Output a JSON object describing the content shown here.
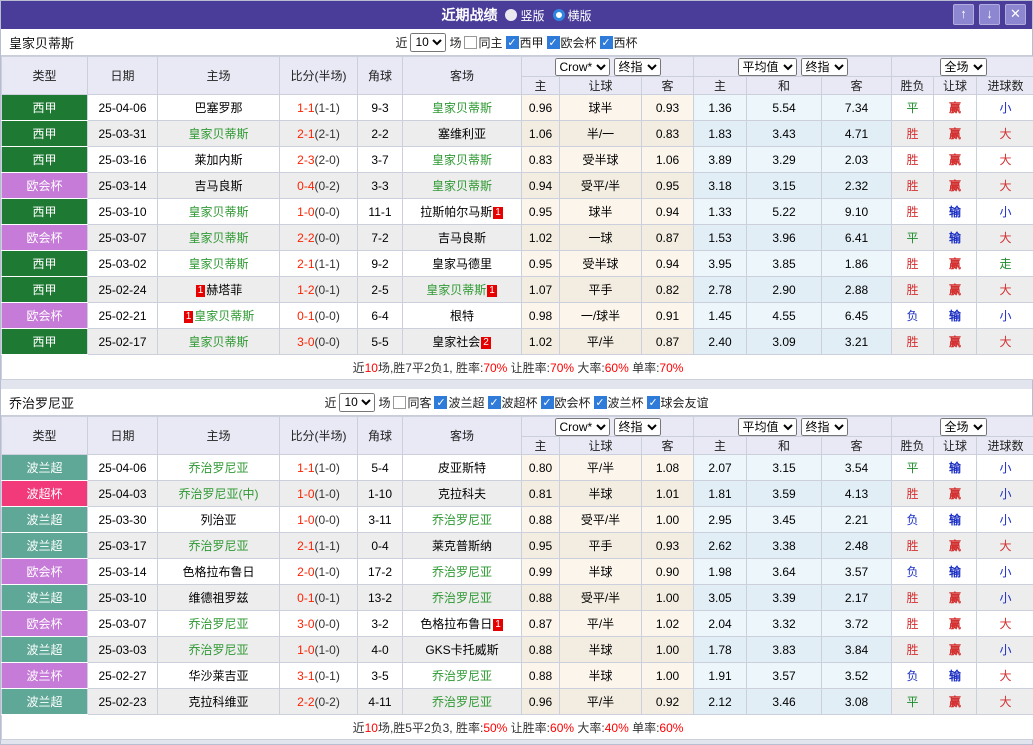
{
  "titlebar": {
    "title": "近期战绩",
    "radio_vertical": "竖版",
    "radio_horizontal": "横版",
    "up": "↑",
    "down": "↓",
    "close": "✕",
    "bg": "#4a3d99"
  },
  "columns": {
    "type": "类型",
    "date": "日期",
    "home": "主场",
    "score": "比分(半场)",
    "corner": "角球",
    "away": "客场",
    "odds_home": "主",
    "odds_handicap": "让球",
    "odds_away": "客",
    "avg_home": "主",
    "avg_draw": "和",
    "avg_away": "客",
    "result_wl": "胜负",
    "result_handicap": "让球",
    "result_goals": "进球数"
  },
  "selects": {
    "crow": "Crow*",
    "final1": "终指",
    "average": "平均值",
    "final2": "终指",
    "fullmatch": "全场"
  },
  "filter_words": {
    "near": "近",
    "games": "场"
  },
  "colors": {
    "league": {
      "西甲": "#1e7a33",
      "欧会杯": "#c77bd8",
      "波兰超": "#5fa897",
      "波超杯": "#f23a7b",
      "波兰杯": "#c77bd8"
    },
    "result": {
      "r": "#d43030",
      "g": "#1d8a2a",
      "b": "#1b2fc4"
    },
    "team_green": "#2e9932",
    "score_red": "#ff2200",
    "badge_red": "#e60000",
    "checkbox_blue": "#2f7bd9"
  },
  "sections": [
    {
      "team": "皇家贝蒂斯",
      "filter": {
        "count": "10",
        "same": "同主",
        "same_checked": false,
        "leagues": [
          "西甲",
          "欧会杯",
          "西杯"
        ]
      },
      "rows": [
        {
          "type": "西甲",
          "date": "25-04-06",
          "home": {
            "name": "巴塞罗那"
          },
          "ft": "1-1",
          "ht": "(1-1)",
          "corner": "9-3",
          "away": {
            "name": "皇家贝蒂斯",
            "green": true
          },
          "o1": "0.96",
          "hcp": "球半",
          "o2": "0.93",
          "a1": "1.36",
          "a2": "5.54",
          "a3": "7.34",
          "r1": {
            "t": "平",
            "c": "g"
          },
          "r2": {
            "t": "赢",
            "c": "r"
          },
          "r3": {
            "t": "小",
            "c": "b"
          }
        },
        {
          "type": "西甲",
          "date": "25-03-31",
          "home": {
            "name": "皇家贝蒂斯",
            "green": true
          },
          "ft": "2-1",
          "ht": "(2-1)",
          "corner": "2-2",
          "away": {
            "name": "塞维利亚"
          },
          "o1": "1.06",
          "hcp": "半/一",
          "o2": "0.83",
          "a1": "1.83",
          "a2": "3.43",
          "a3": "4.71",
          "r1": {
            "t": "胜",
            "c": "r"
          },
          "r2": {
            "t": "赢",
            "c": "r"
          },
          "r3": {
            "t": "大",
            "c": "r"
          }
        },
        {
          "type": "西甲",
          "date": "25-03-16",
          "home": {
            "name": "莱加内斯"
          },
          "ft": "2-3",
          "ht": "(2-0)",
          "corner": "3-7",
          "away": {
            "name": "皇家贝蒂斯",
            "green": true
          },
          "o1": "0.83",
          "hcp": "受半球",
          "o2": "1.06",
          "a1": "3.89",
          "a2": "3.29",
          "a3": "2.03",
          "r1": {
            "t": "胜",
            "c": "r"
          },
          "r2": {
            "t": "赢",
            "c": "r"
          },
          "r3": {
            "t": "大",
            "c": "r"
          }
        },
        {
          "type": "欧会杯",
          "date": "25-03-14",
          "home": {
            "name": "吉马良斯"
          },
          "ft": "0-4",
          "ht": "(0-2)",
          "corner": "3-3",
          "away": {
            "name": "皇家贝蒂斯",
            "green": true
          },
          "o1": "0.94",
          "hcp": "受平/半",
          "o2": "0.95",
          "a1": "3.18",
          "a2": "3.15",
          "a3": "2.32",
          "r1": {
            "t": "胜",
            "c": "r"
          },
          "r2": {
            "t": "赢",
            "c": "r"
          },
          "r3": {
            "t": "大",
            "c": "r"
          }
        },
        {
          "type": "西甲",
          "date": "25-03-10",
          "home": {
            "name": "皇家贝蒂斯",
            "green": true
          },
          "ft": "1-0",
          "ht": "(0-0)",
          "corner": "11-1",
          "away": {
            "name": "拉斯帕尔马斯",
            "suf": "1"
          },
          "o1": "0.95",
          "hcp": "球半",
          "o2": "0.94",
          "a1": "1.33",
          "a2": "5.22",
          "a3": "9.10",
          "r1": {
            "t": "胜",
            "c": "r"
          },
          "r2": {
            "t": "输",
            "c": "b"
          },
          "r3": {
            "t": "小",
            "c": "b"
          }
        },
        {
          "type": "欧会杯",
          "date": "25-03-07",
          "home": {
            "name": "皇家贝蒂斯",
            "green": true
          },
          "ft": "2-2",
          "ht": "(0-0)",
          "corner": "7-2",
          "away": {
            "name": "吉马良斯"
          },
          "o1": "1.02",
          "hcp": "一球",
          "o2": "0.87",
          "a1": "1.53",
          "a2": "3.96",
          "a3": "6.41",
          "r1": {
            "t": "平",
            "c": "g"
          },
          "r2": {
            "t": "输",
            "c": "b"
          },
          "r3": {
            "t": "大",
            "c": "r"
          }
        },
        {
          "type": "西甲",
          "date": "25-03-02",
          "home": {
            "name": "皇家贝蒂斯",
            "green": true
          },
          "ft": "2-1",
          "ht": "(1-1)",
          "corner": "9-2",
          "away": {
            "name": "皇家马德里"
          },
          "o1": "0.95",
          "hcp": "受半球",
          "o2": "0.94",
          "a1": "3.95",
          "a2": "3.85",
          "a3": "1.86",
          "r1": {
            "t": "胜",
            "c": "r"
          },
          "r2": {
            "t": "赢",
            "c": "r"
          },
          "r3": {
            "t": "走",
            "c": "g"
          }
        },
        {
          "type": "西甲",
          "date": "25-02-24",
          "home": {
            "name": "赫塔菲",
            "pre": "1"
          },
          "ft": "1-2",
          "ht": "(0-1)",
          "corner": "2-5",
          "away": {
            "name": "皇家贝蒂斯",
            "green": true,
            "suf": "1"
          },
          "o1": "1.07",
          "hcp": "平手",
          "o2": "0.82",
          "a1": "2.78",
          "a2": "2.90",
          "a3": "2.88",
          "r1": {
            "t": "胜",
            "c": "r"
          },
          "r2": {
            "t": "赢",
            "c": "r"
          },
          "r3": {
            "t": "大",
            "c": "r"
          }
        },
        {
          "type": "欧会杯",
          "date": "25-02-21",
          "home": {
            "name": "皇家贝蒂斯",
            "green": true,
            "pre": "1"
          },
          "ft": "0-1",
          "ht": "(0-0)",
          "corner": "6-4",
          "away": {
            "name": "根特"
          },
          "o1": "0.98",
          "hcp": "一/球半",
          "o2": "0.91",
          "a1": "1.45",
          "a2": "4.55",
          "a3": "6.45",
          "r1": {
            "t": "负",
            "c": "b"
          },
          "r2": {
            "t": "输",
            "c": "b"
          },
          "r3": {
            "t": "小",
            "c": "b"
          }
        },
        {
          "type": "西甲",
          "date": "25-02-17",
          "home": {
            "name": "皇家贝蒂斯",
            "green": true
          },
          "ft": "3-0",
          "ht": "(0-0)",
          "corner": "5-5",
          "away": {
            "name": "皇家社会",
            "suf": "2"
          },
          "o1": "1.02",
          "hcp": "平/半",
          "o2": "0.87",
          "a1": "2.40",
          "a2": "3.09",
          "a3": "3.21",
          "r1": {
            "t": "胜",
            "c": "r"
          },
          "r2": {
            "t": "赢",
            "c": "r"
          },
          "r3": {
            "t": "大",
            "c": "r"
          }
        }
      ],
      "summary": [
        {
          "t": "近",
          "red": false
        },
        {
          "t": "10",
          "red": true
        },
        {
          "t": "场,胜7平2负1, 胜率:",
          "red": false
        },
        {
          "t": "70%",
          "red": true
        },
        {
          "t": " 让胜率:",
          "red": false
        },
        {
          "t": "70%",
          "red": true
        },
        {
          "t": " 大率:",
          "red": false
        },
        {
          "t": "60%",
          "red": true
        },
        {
          "t": " 单率:",
          "red": false
        },
        {
          "t": "70%",
          "red": true
        }
      ]
    },
    {
      "team": "乔治罗尼亚",
      "filter": {
        "count": "10",
        "same": "同客",
        "same_checked": false,
        "leagues": [
          "波兰超",
          "波超杯",
          "欧会杯",
          "波兰杯",
          "球会友谊"
        ]
      },
      "rows": [
        {
          "type": "波兰超",
          "date": "25-04-06",
          "home": {
            "name": "乔治罗尼亚",
            "green": true
          },
          "ft": "1-1",
          "ht": "(1-0)",
          "corner": "5-4",
          "away": {
            "name": "皮亚斯特"
          },
          "o1": "0.80",
          "hcp": "平/半",
          "o2": "1.08",
          "a1": "2.07",
          "a2": "3.15",
          "a3": "3.54",
          "r1": {
            "t": "平",
            "c": "g"
          },
          "r2": {
            "t": "输",
            "c": "b"
          },
          "r3": {
            "t": "小",
            "c": "b"
          }
        },
        {
          "type": "波超杯",
          "date": "25-04-03",
          "home": {
            "name": "乔治罗尼亚(中)",
            "green": true
          },
          "ft": "1-0",
          "ht": "(1-0)",
          "corner": "1-10",
          "away": {
            "name": "克拉科夫"
          },
          "o1": "0.81",
          "hcp": "半球",
          "o2": "1.01",
          "a1": "1.81",
          "a2": "3.59",
          "a3": "4.13",
          "r1": {
            "t": "胜",
            "c": "r"
          },
          "r2": {
            "t": "赢",
            "c": "r"
          },
          "r3": {
            "t": "小",
            "c": "b"
          }
        },
        {
          "type": "波兰超",
          "date": "25-03-30",
          "home": {
            "name": "列治亚"
          },
          "ft": "1-0",
          "ht": "(0-0)",
          "corner": "3-11",
          "away": {
            "name": "乔治罗尼亚",
            "green": true
          },
          "o1": "0.88",
          "hcp": "受平/半",
          "o2": "1.00",
          "a1": "2.95",
          "a2": "3.45",
          "a3": "2.21",
          "r1": {
            "t": "负",
            "c": "b"
          },
          "r2": {
            "t": "输",
            "c": "b"
          },
          "r3": {
            "t": "小",
            "c": "b"
          }
        },
        {
          "type": "波兰超",
          "date": "25-03-17",
          "home": {
            "name": "乔治罗尼亚",
            "green": true
          },
          "ft": "2-1",
          "ht": "(1-1)",
          "corner": "0-4",
          "away": {
            "name": "莱克普斯纳"
          },
          "o1": "0.95",
          "hcp": "平手",
          "o2": "0.93",
          "a1": "2.62",
          "a2": "3.38",
          "a3": "2.48",
          "r1": {
            "t": "胜",
            "c": "r"
          },
          "r2": {
            "t": "赢",
            "c": "r"
          },
          "r3": {
            "t": "大",
            "c": "r"
          }
        },
        {
          "type": "欧会杯",
          "date": "25-03-14",
          "home": {
            "name": "色格拉布鲁日"
          },
          "ft": "2-0",
          "ht": "(1-0)",
          "corner": "17-2",
          "away": {
            "name": "乔治罗尼亚",
            "green": true
          },
          "o1": "0.99",
          "hcp": "半球",
          "o2": "0.90",
          "a1": "1.98",
          "a2": "3.64",
          "a3": "3.57",
          "r1": {
            "t": "负",
            "c": "b"
          },
          "r2": {
            "t": "输",
            "c": "b"
          },
          "r3": {
            "t": "小",
            "c": "b"
          }
        },
        {
          "type": "波兰超",
          "date": "25-03-10",
          "home": {
            "name": "维德祖罗兹"
          },
          "ft": "0-1",
          "ht": "(0-1)",
          "corner": "13-2",
          "away": {
            "name": "乔治罗尼亚",
            "green": true
          },
          "o1": "0.88",
          "hcp": "受平/半",
          "o2": "1.00",
          "a1": "3.05",
          "a2": "3.39",
          "a3": "2.17",
          "r1": {
            "t": "胜",
            "c": "r"
          },
          "r2": {
            "t": "赢",
            "c": "r"
          },
          "r3": {
            "t": "小",
            "c": "b"
          }
        },
        {
          "type": "欧会杯",
          "date": "25-03-07",
          "home": {
            "name": "乔治罗尼亚",
            "green": true
          },
          "ft": "3-0",
          "ht": "(0-0)",
          "corner": "3-2",
          "away": {
            "name": "色格拉布鲁日",
            "suf": "1"
          },
          "o1": "0.87",
          "hcp": "平/半",
          "o2": "1.02",
          "a1": "2.04",
          "a2": "3.32",
          "a3": "3.72",
          "r1": {
            "t": "胜",
            "c": "r"
          },
          "r2": {
            "t": "赢",
            "c": "r"
          },
          "r3": {
            "t": "大",
            "c": "r"
          }
        },
        {
          "type": "波兰超",
          "date": "25-03-03",
          "home": {
            "name": "乔治罗尼亚",
            "green": true
          },
          "ft": "1-0",
          "ht": "(1-0)",
          "corner": "4-0",
          "away": {
            "name": "GKS卡托威斯"
          },
          "o1": "0.88",
          "hcp": "半球",
          "o2": "1.00",
          "a1": "1.78",
          "a2": "3.83",
          "a3": "3.84",
          "r1": {
            "t": "胜",
            "c": "r"
          },
          "r2": {
            "t": "赢",
            "c": "r"
          },
          "r3": {
            "t": "小",
            "c": "b"
          }
        },
        {
          "type": "波兰杯",
          "date": "25-02-27",
          "home": {
            "name": "华沙莱吉亚"
          },
          "ft": "3-1",
          "ht": "(0-1)",
          "corner": "3-5",
          "away": {
            "name": "乔治罗尼亚",
            "green": true
          },
          "o1": "0.88",
          "hcp": "半球",
          "o2": "1.00",
          "a1": "1.91",
          "a2": "3.57",
          "a3": "3.52",
          "r1": {
            "t": "负",
            "c": "b"
          },
          "r2": {
            "t": "输",
            "c": "b"
          },
          "r3": {
            "t": "大",
            "c": "r"
          }
        },
        {
          "type": "波兰超",
          "date": "25-02-23",
          "home": {
            "name": "克拉科维亚"
          },
          "ft": "2-2",
          "ht": "(0-2)",
          "corner": "4-11",
          "away": {
            "name": "乔治罗尼亚",
            "green": true
          },
          "o1": "0.96",
          "hcp": "平/半",
          "o2": "0.92",
          "a1": "2.12",
          "a2": "3.46",
          "a3": "3.08",
          "r1": {
            "t": "平",
            "c": "g"
          },
          "r2": {
            "t": "赢",
            "c": "r"
          },
          "r3": {
            "t": "大",
            "c": "r"
          }
        }
      ],
      "summary": [
        {
          "t": "近",
          "red": false
        },
        {
          "t": "10",
          "red": true
        },
        {
          "t": "场,胜5平2负3, 胜率:",
          "red": false
        },
        {
          "t": "50%",
          "red": true
        },
        {
          "t": " 让胜率:",
          "red": false
        },
        {
          "t": "60%",
          "red": true
        },
        {
          "t": " 大率:",
          "red": false
        },
        {
          "t": "40%",
          "red": true
        },
        {
          "t": " 单率:",
          "red": false
        },
        {
          "t": "60%",
          "red": true
        }
      ]
    }
  ]
}
